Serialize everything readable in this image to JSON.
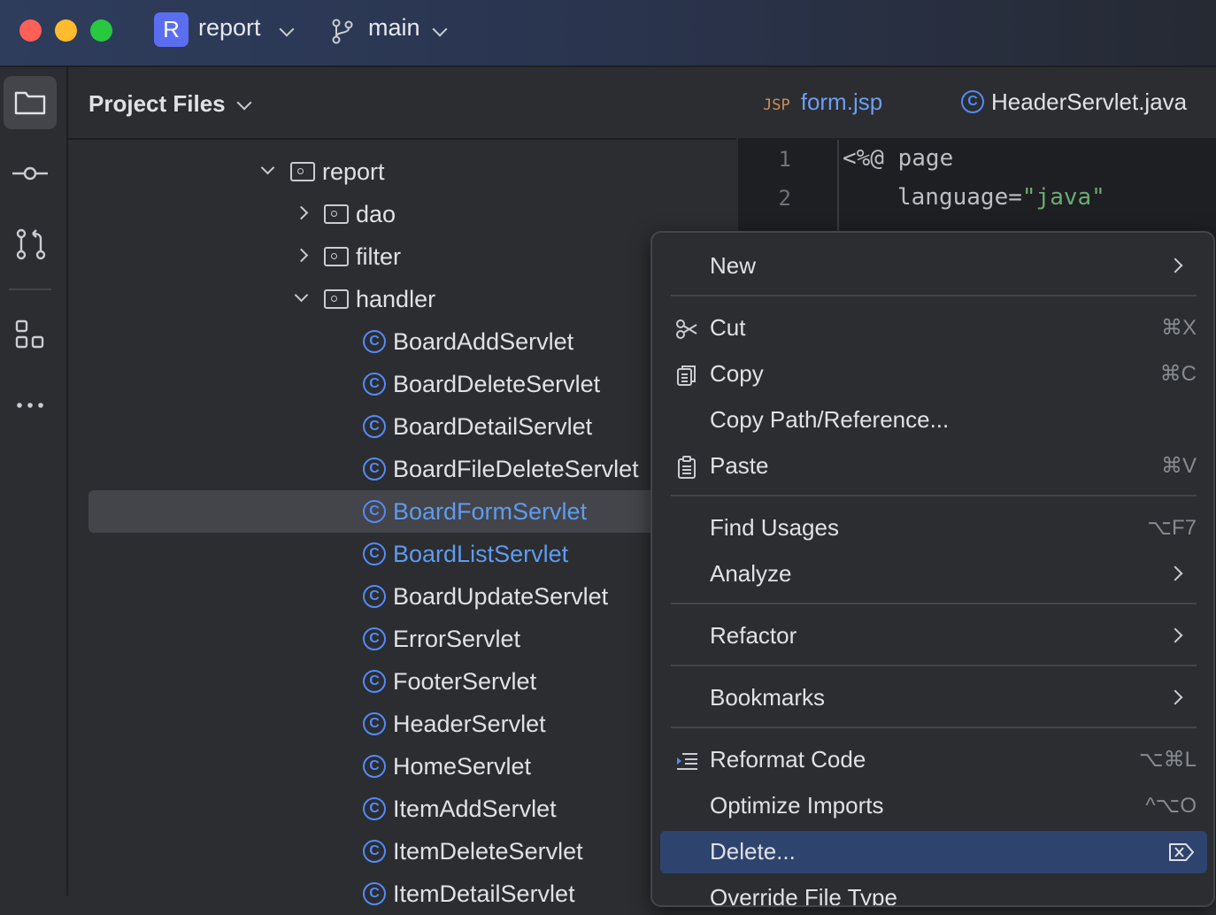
{
  "titlebar": {
    "project_badge": "R",
    "project_name": "report",
    "branch_name": "main"
  },
  "panel": {
    "title": "Project Files"
  },
  "tree": {
    "report": "report",
    "dao": "dao",
    "filter": "filter",
    "handler": "handler",
    "class_badge": "C",
    "classes": [
      {
        "name": "BoardAddServlet",
        "modified": false
      },
      {
        "name": "BoardDeleteServlet",
        "modified": false
      },
      {
        "name": "BoardDetailServlet",
        "modified": false
      },
      {
        "name": "BoardFileDeleteServlet",
        "modified": false
      },
      {
        "name": "BoardFormServlet",
        "modified": true,
        "selected": true
      },
      {
        "name": "BoardListServlet",
        "modified": true
      },
      {
        "name": "BoardUpdateServlet",
        "modified": false
      },
      {
        "name": "ErrorServlet",
        "modified": false
      },
      {
        "name": "FooterServlet",
        "modified": false
      },
      {
        "name": "HeaderServlet",
        "modified": false
      },
      {
        "name": "HomeServlet",
        "modified": false
      },
      {
        "name": "ItemAddServlet",
        "modified": false
      },
      {
        "name": "ItemDeleteServlet",
        "modified": false
      },
      {
        "name": "ItemDetailServlet",
        "modified": false
      }
    ]
  },
  "editor": {
    "tabs": [
      {
        "badge": "JSP",
        "label": "form.jsp",
        "active": true
      },
      {
        "badge": "C",
        "label": "HeaderServlet.java",
        "active": false
      }
    ],
    "line_numbers": [
      "1",
      "2"
    ],
    "code": {
      "line1": "<%@ page",
      "line2_attr": "language=",
      "line2_value": "\"java\""
    }
  },
  "context_menu": {
    "items": [
      {
        "id": "new",
        "label": "New",
        "shortcut": "",
        "submenu": true
      },
      {
        "id": "cut",
        "label": "Cut",
        "shortcut": "⌘X",
        "icon": "scissors-icon"
      },
      {
        "id": "copy",
        "label": "Copy",
        "shortcut": "⌘C",
        "icon": "copy-icon"
      },
      {
        "id": "copy_path",
        "label": "Copy Path/Reference...",
        "shortcut": ""
      },
      {
        "id": "paste",
        "label": "Paste",
        "shortcut": "⌘V",
        "icon": "clipboard-icon"
      },
      {
        "id": "find_usages",
        "label": "Find Usages",
        "shortcut": "⌥F7"
      },
      {
        "id": "analyze",
        "label": "Analyze",
        "shortcut": "",
        "submenu": true
      },
      {
        "id": "refactor",
        "label": "Refactor",
        "shortcut": "",
        "submenu": true
      },
      {
        "id": "bookmarks",
        "label": "Bookmarks",
        "shortcut": "",
        "submenu": true
      },
      {
        "id": "reformat",
        "label": "Reformat Code",
        "shortcut": "⌥⌘L",
        "icon": "reformat-icon"
      },
      {
        "id": "optimize_imports",
        "label": "Optimize Imports",
        "shortcut": "^⌥O"
      },
      {
        "id": "delete",
        "label": "Delete...",
        "shortcut": "",
        "highlighted": true,
        "icon": "delete-key-icon"
      },
      {
        "id": "override_file_type",
        "label": "Override File Type",
        "shortcut": ""
      }
    ]
  },
  "colors": {
    "accent": "#548af7",
    "modified_text": "#5f9bef",
    "menu_highlight": "#2e436e",
    "selection": "#43454a"
  }
}
